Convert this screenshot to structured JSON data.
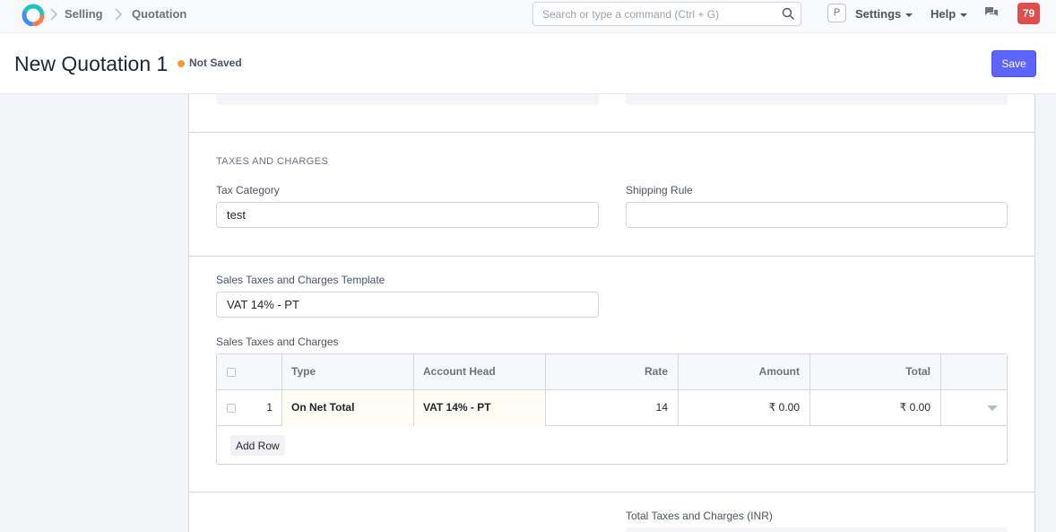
{
  "navbar": {
    "breadcrumbs": [
      "Selling",
      "Quotation"
    ],
    "search_placeholder": "Search or type a command (Ctrl + G)",
    "avatar_initial": "P",
    "settings_label": "Settings",
    "help_label": "Help",
    "notification_count": "79"
  },
  "page": {
    "title": "New Quotation 1",
    "status": "Not Saved",
    "status_color": "#f39c35",
    "save_label": "Save"
  },
  "taxes_section": {
    "title": "TAXES AND CHARGES",
    "tax_category_label": "Tax Category",
    "tax_category_value": "test",
    "shipping_rule_label": "Shipping Rule",
    "shipping_rule_value": ""
  },
  "template_section": {
    "template_label": "Sales Taxes and Charges Template",
    "template_value": "VAT 14% - PT",
    "table_label": "Sales Taxes and Charges",
    "columns": [
      "Type",
      "Account Head",
      "Rate",
      "Amount",
      "Total"
    ],
    "rows": [
      {
        "idx": "1",
        "type": "On Net Total",
        "account_head": "VAT 14% - PT",
        "rate": "14",
        "amount": "₹ 0.00",
        "total": "₹ 0.00"
      }
    ],
    "add_row_label": "Add Row"
  },
  "totals_section": {
    "total_taxes_label": "Total Taxes and Charges (INR)"
  },
  "colors": {
    "primary": "#5e64ff",
    "notification": "#e24c4c"
  }
}
